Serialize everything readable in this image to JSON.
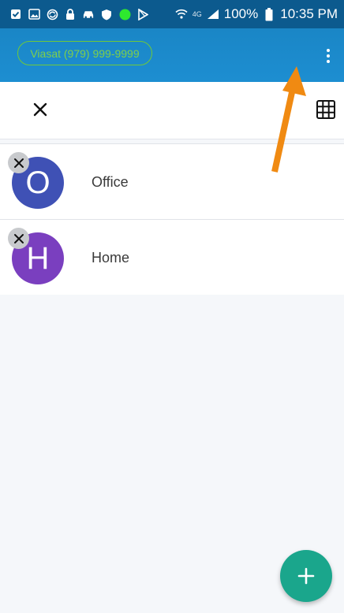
{
  "status_bar": {
    "battery": "100%",
    "time": "10:35 PM",
    "network": "4G",
    "left_icons": [
      "checkbox-icon",
      "image-icon",
      "sync-icon",
      "lock-icon",
      "car-icon",
      "shield-icon",
      "green-dot-icon",
      "play-store-icon"
    ]
  },
  "header": {
    "account_label": "Viasat (979) 999-9999",
    "accent_color": "#1a86c6",
    "pill_color": "#6fc93a"
  },
  "toolbar": {
    "close_icon": "close-icon",
    "grid_icon": "grid-icon"
  },
  "contacts": [
    {
      "initial": "O",
      "label": "Office",
      "color": "#3f51b5"
    },
    {
      "initial": "H",
      "label": "Home",
      "color": "#7a3fbf"
    }
  ],
  "fab": {
    "icon": "plus-icon",
    "color": "#1aa68c"
  },
  "annotation": {
    "arrow_color": "#f08a12"
  }
}
